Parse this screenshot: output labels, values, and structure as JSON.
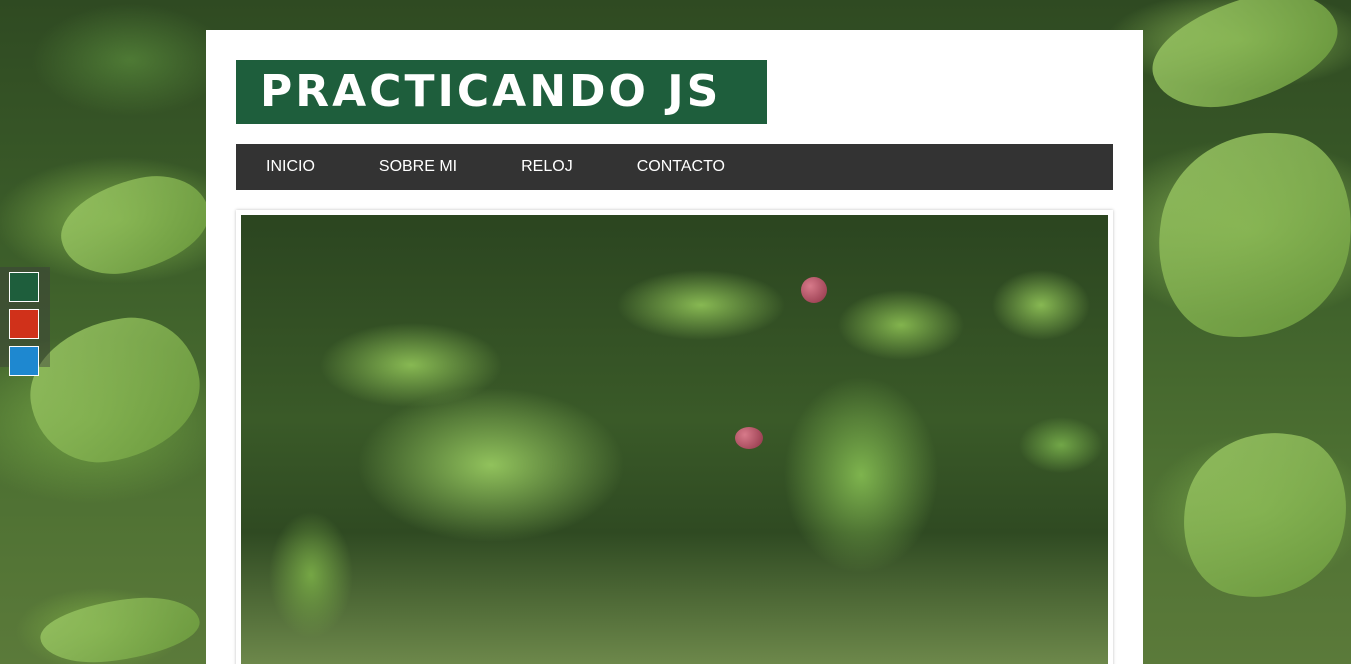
{
  "header": {
    "logo_text": "PRACTICANDO JS"
  },
  "nav": {
    "items": [
      {
        "label": "INICIO"
      },
      {
        "label": "SOBRE MI"
      },
      {
        "label": "RELOJ"
      },
      {
        "label": "CONTACTO"
      }
    ]
  },
  "banner": {
    "image": "beech-leaves-photo"
  },
  "theme_switcher": {
    "colors": [
      "#1e5e3c",
      "#d0311a",
      "#1e88d0"
    ]
  },
  "colors": {
    "brand": "#1e5e3c",
    "nav_background": "#333333",
    "page_background": "#ffffff"
  }
}
